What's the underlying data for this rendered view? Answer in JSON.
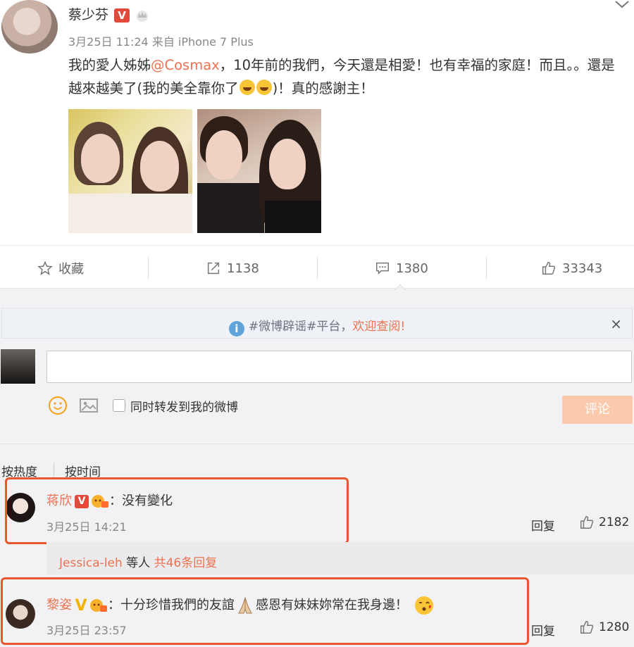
{
  "post": {
    "author": "蔡少芬",
    "badge": "V",
    "date": "3月25日 11:24",
    "source": "来自 iPhone 7 Plus",
    "text_part1": "我的愛人姊姊",
    "mention": "@Cosmax",
    "text_part2": "，10年前的我們，今天還是相愛！也有幸福的家庭！而且。。還是越來越美了(我的美全靠你了",
    "text_part3": ")！真的感謝主！"
  },
  "actions": {
    "favorite": "收藏",
    "repost_count": "1138",
    "comment_count": "1380",
    "like_count": "33343"
  },
  "notice": {
    "text": "#微博辟谣#平台，",
    "link": "欢迎查阅!",
    "close": "×"
  },
  "composer": {
    "repost_label": "同时转发到我的微博",
    "submit_label": "评论"
  },
  "sort": {
    "hot": "按热度",
    "time": "按时间"
  },
  "comments": [
    {
      "name": "蒋欣",
      "badge": "V",
      "text": "：没有變化",
      "time": "3月25日 14:21",
      "reply": "回复",
      "likes": "2182"
    },
    {
      "name": "黎姿",
      "badge": "V",
      "text_part1": "：十分珍惜我們的友誼",
      "text_part2": "感恩有妹妹妳常在我身邊！",
      "time": "3月25日 23:57",
      "reply": "回复",
      "likes": "1280"
    }
  ],
  "replies": {
    "user": "Jessica-leh",
    "suffix": " 等人 ",
    "count": "共46条回复"
  },
  "colors": {
    "accent": "#eb7350",
    "highlight": "#e9572c",
    "vbadge": "#e2493b",
    "submit": "#fbc9ac"
  }
}
